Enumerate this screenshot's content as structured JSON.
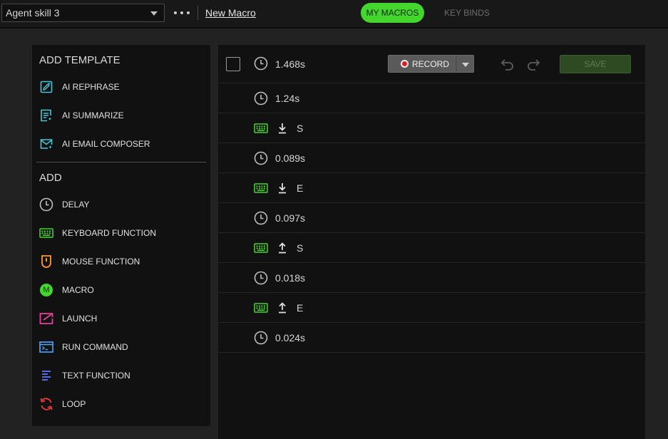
{
  "topbar": {
    "profile": "Agent skill 3",
    "new_macro_link": "New Macro",
    "tabs": [
      {
        "label": "MY MACROS",
        "active": true
      },
      {
        "label": "KEY BINDS",
        "active": false
      }
    ]
  },
  "left_panel": {
    "template_title": "ADD TEMPLATE",
    "templates": [
      {
        "label": "AI REPHRASE",
        "icon": "ai-rephrase-icon"
      },
      {
        "label": "AI SUMMARIZE",
        "icon": "ai-summarize-icon"
      },
      {
        "label": "AI EMAIL COMPOSER",
        "icon": "ai-email-icon"
      }
    ],
    "add_title": "ADD",
    "add_items": [
      {
        "label": "DELAY",
        "icon": "clock-icon"
      },
      {
        "label": "KEYBOARD FUNCTION",
        "icon": "keyboard-icon"
      },
      {
        "label": "MOUSE FUNCTION",
        "icon": "mouse-icon"
      },
      {
        "label": "MACRO",
        "icon": "macro-icon",
        "glyph": "M"
      },
      {
        "label": "LAUNCH",
        "icon": "launch-icon"
      },
      {
        "label": "RUN COMMAND",
        "icon": "terminal-icon"
      },
      {
        "label": "TEXT FUNCTION",
        "icon": "text-lines-icon"
      },
      {
        "label": "LOOP",
        "icon": "loop-icon"
      }
    ]
  },
  "toolbar": {
    "record_label": "RECORD",
    "save_label": "SAVE"
  },
  "macro_steps": [
    {
      "type": "delay",
      "value": "1.468s"
    },
    {
      "type": "delay",
      "value": "1.24s"
    },
    {
      "type": "key",
      "direction": "down",
      "key": "S"
    },
    {
      "type": "delay",
      "value": "0.089s"
    },
    {
      "type": "key",
      "direction": "down",
      "key": "E"
    },
    {
      "type": "delay",
      "value": "0.097s"
    },
    {
      "type": "key",
      "direction": "up",
      "key": "S"
    },
    {
      "type": "delay",
      "value": "0.018s"
    },
    {
      "type": "key",
      "direction": "up",
      "key": "E"
    },
    {
      "type": "delay",
      "value": "0.024s"
    }
  ],
  "colors": {
    "accent_green": "#44d62c",
    "cyan": "#44c8d8",
    "orange": "#ff9a2e",
    "pink": "#e8409a",
    "blue": "#4aa8ff",
    "text_blue": "#5a78ff",
    "red": "#e83a3a"
  }
}
